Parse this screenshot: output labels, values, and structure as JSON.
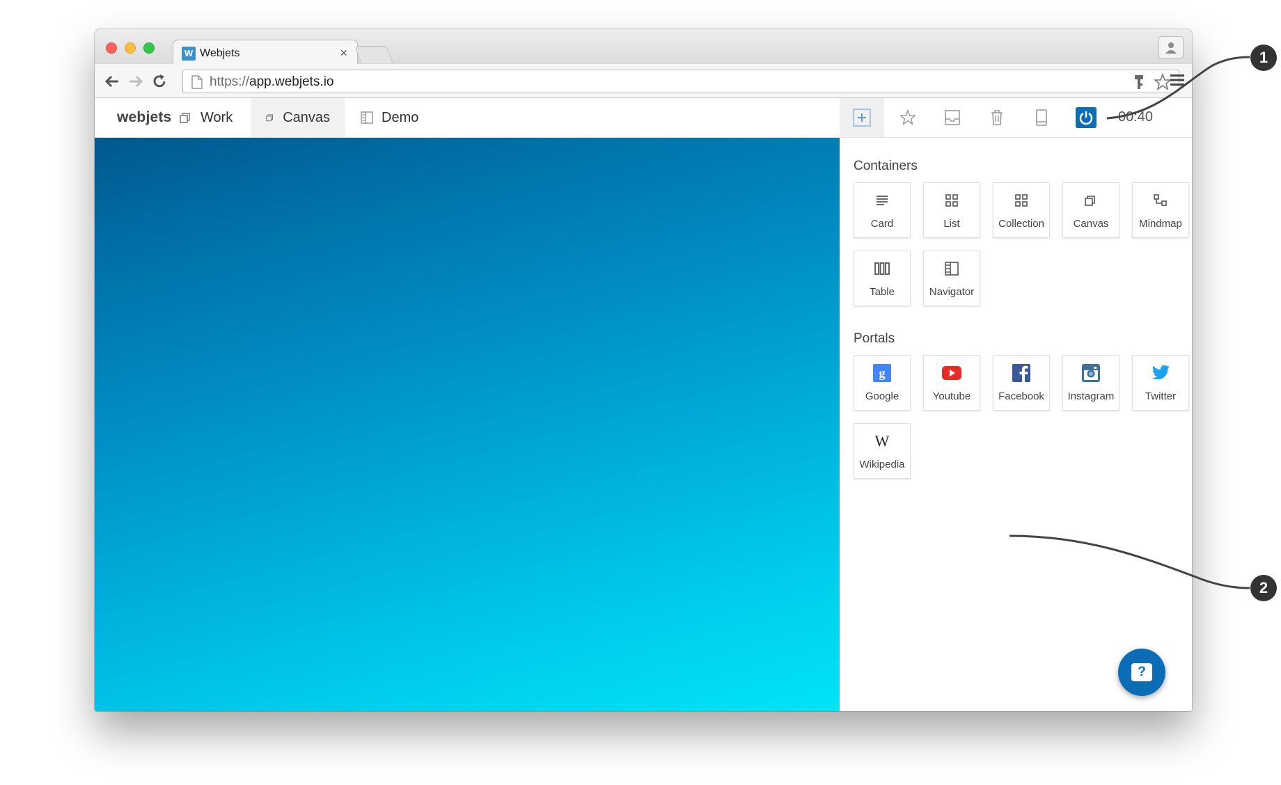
{
  "browser": {
    "tab_title": "Webjets",
    "tab_favicon": "W",
    "tab_close": "×",
    "url_scheme": "https://",
    "url_host": "app.webjets.io"
  },
  "app": {
    "brand": "webjets",
    "nav_tabs": [
      {
        "label": "Work",
        "icon": "canvas-stack-icon"
      },
      {
        "label": "Canvas",
        "icon": "canvas-stack-icon",
        "active": true
      },
      {
        "label": "Demo",
        "icon": "navigator-icon"
      }
    ],
    "toolbar": {
      "tools": [
        "add-icon",
        "star-icon",
        "inbox-icon",
        "trash-icon",
        "tablet-icon",
        "power-icon"
      ],
      "timer": "00:40"
    }
  },
  "panel": {
    "containers_title": "Containers",
    "containers": [
      {
        "label": "Card",
        "icon": "lines-icon"
      },
      {
        "label": "List",
        "icon": "grid-icon"
      },
      {
        "label": "Collection",
        "icon": "grid-icon"
      },
      {
        "label": "Canvas",
        "icon": "canvas-stack-icon"
      },
      {
        "label": "Mindmap",
        "icon": "mindmap-icon"
      },
      {
        "label": "Table",
        "icon": "columns-icon"
      },
      {
        "label": "Navigator",
        "icon": "navigator-icon"
      }
    ],
    "portals_title": "Portals",
    "portals": [
      {
        "label": "Google",
        "icon": "google-icon",
        "color": "#4285f4"
      },
      {
        "label": "Youtube",
        "icon": "youtube-icon",
        "color": "#e52d27"
      },
      {
        "label": "Facebook",
        "icon": "facebook-icon",
        "color": "#3b5998"
      },
      {
        "label": "Instagram",
        "icon": "instagram-icon",
        "color": "#3f729b"
      },
      {
        "label": "Twitter",
        "icon": "twitter-icon",
        "color": "#1da1f2"
      },
      {
        "label": "Wikipedia",
        "icon": "wikipedia-icon",
        "color": "#222222"
      }
    ],
    "help_label": "?"
  },
  "callouts": [
    "1",
    "2"
  ],
  "colors": {
    "accent": "#0b6db6",
    "canvas_top": "#00588c",
    "canvas_bottom": "#00e3f6"
  }
}
